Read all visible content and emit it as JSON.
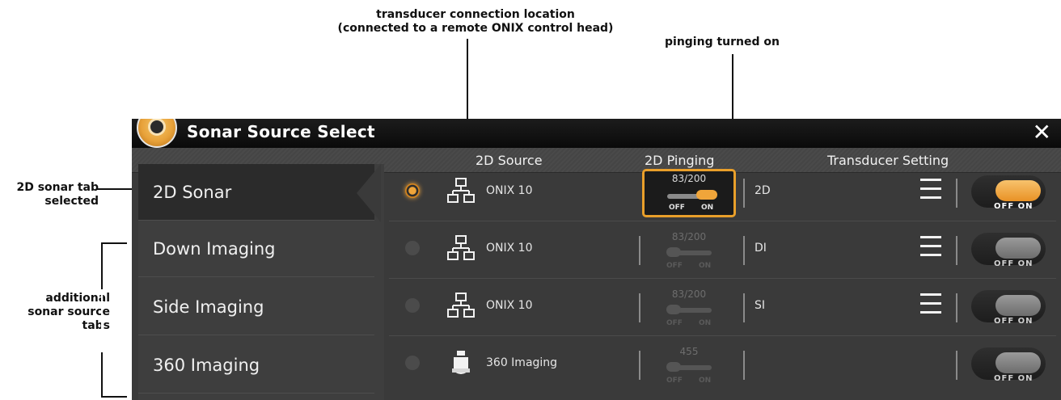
{
  "annotations": {
    "transducer_callout_line1": "transducer connection location",
    "transducer_callout_line2": "(connected to a remote ONIX control head)",
    "pinging_callout": "pinging turned on",
    "tab_selected_line1": "2D sonar tab",
    "tab_selected_line2": "selected",
    "additional_tabs_line1": "additional",
    "additional_tabs_line2": "sonar source",
    "additional_tabs_line3": "tabs"
  },
  "window": {
    "title": "Sonar Source Select",
    "close_glyph": "✕"
  },
  "columns": {
    "source": "2D Source",
    "pinging": "2D Pinging",
    "transducer": "Transducer Setting"
  },
  "tabs": [
    {
      "label": "2D Sonar",
      "selected": true
    },
    {
      "label": "Down Imaging",
      "selected": false
    },
    {
      "label": "Side Imaging",
      "selected": false
    },
    {
      "label": "360 Imaging",
      "selected": false
    }
  ],
  "rows": [
    {
      "selected": true,
      "source_icon": "network-icon",
      "source": "ONIX 10",
      "ping_value": "83/200",
      "ping_off": "OFF",
      "ping_on": "ON",
      "pinging": "on",
      "transducer": "2D",
      "toggle": "on",
      "toggle_label": "OFF ON"
    },
    {
      "selected": false,
      "source_icon": "network-icon",
      "source": "ONIX 10",
      "ping_value": "83/200",
      "ping_off": "OFF",
      "ping_on": "ON",
      "pinging": "off",
      "transducer": "DI",
      "toggle": "off",
      "toggle_label": "OFF ON"
    },
    {
      "selected": false,
      "source_icon": "network-icon",
      "source": "ONIX 10",
      "ping_value": "83/200",
      "ping_off": "OFF",
      "ping_on": "ON",
      "pinging": "off",
      "transducer": "SI",
      "toggle": "off",
      "toggle_label": "OFF ON"
    },
    {
      "selected": false,
      "source_icon": "transducer-360-icon",
      "source": "360 Imaging",
      "ping_value": "455",
      "ping_off": "OFF",
      "ping_on": "ON",
      "pinging": "off",
      "transducer": "",
      "toggle": "off",
      "toggle_label": "OFF ON"
    }
  ],
  "colors": {
    "accent": "#e99f2a",
    "window_bg": "#3a3a3a",
    "titlebar": "#111111"
  }
}
